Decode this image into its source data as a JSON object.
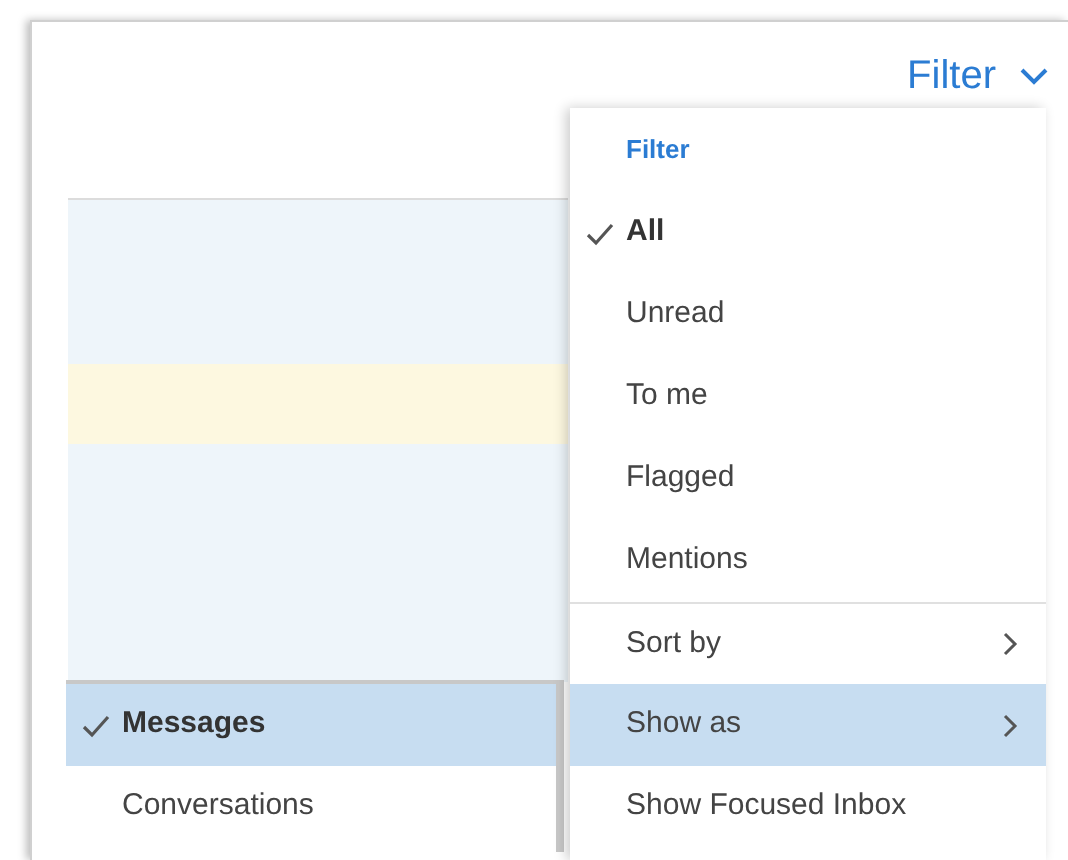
{
  "filter_button": {
    "label": "Filter"
  },
  "message_rows": [
    {
      "highlighted": false
    },
    {
      "highlighted": true
    },
    {
      "highlighted": false
    }
  ],
  "filter_menu": {
    "heading": "Filter",
    "items": [
      {
        "kind": "option",
        "label": "All",
        "selected": true
      },
      {
        "kind": "option",
        "label": "Unread",
        "selected": false
      },
      {
        "kind": "option",
        "label": "To me",
        "selected": false
      },
      {
        "kind": "option",
        "label": "Flagged",
        "selected": false
      },
      {
        "kind": "option",
        "label": "Mentions",
        "selected": false
      },
      {
        "kind": "submenu",
        "label": "Sort by",
        "selected": false
      },
      {
        "kind": "submenu",
        "label": "Show as",
        "selected": true
      },
      {
        "kind": "action",
        "label": "Show Focused Inbox",
        "selected": false
      }
    ]
  },
  "show_as_menu": {
    "items": [
      {
        "label": "Messages",
        "selected": true
      },
      {
        "label": "Conversations",
        "selected": false
      }
    ]
  }
}
